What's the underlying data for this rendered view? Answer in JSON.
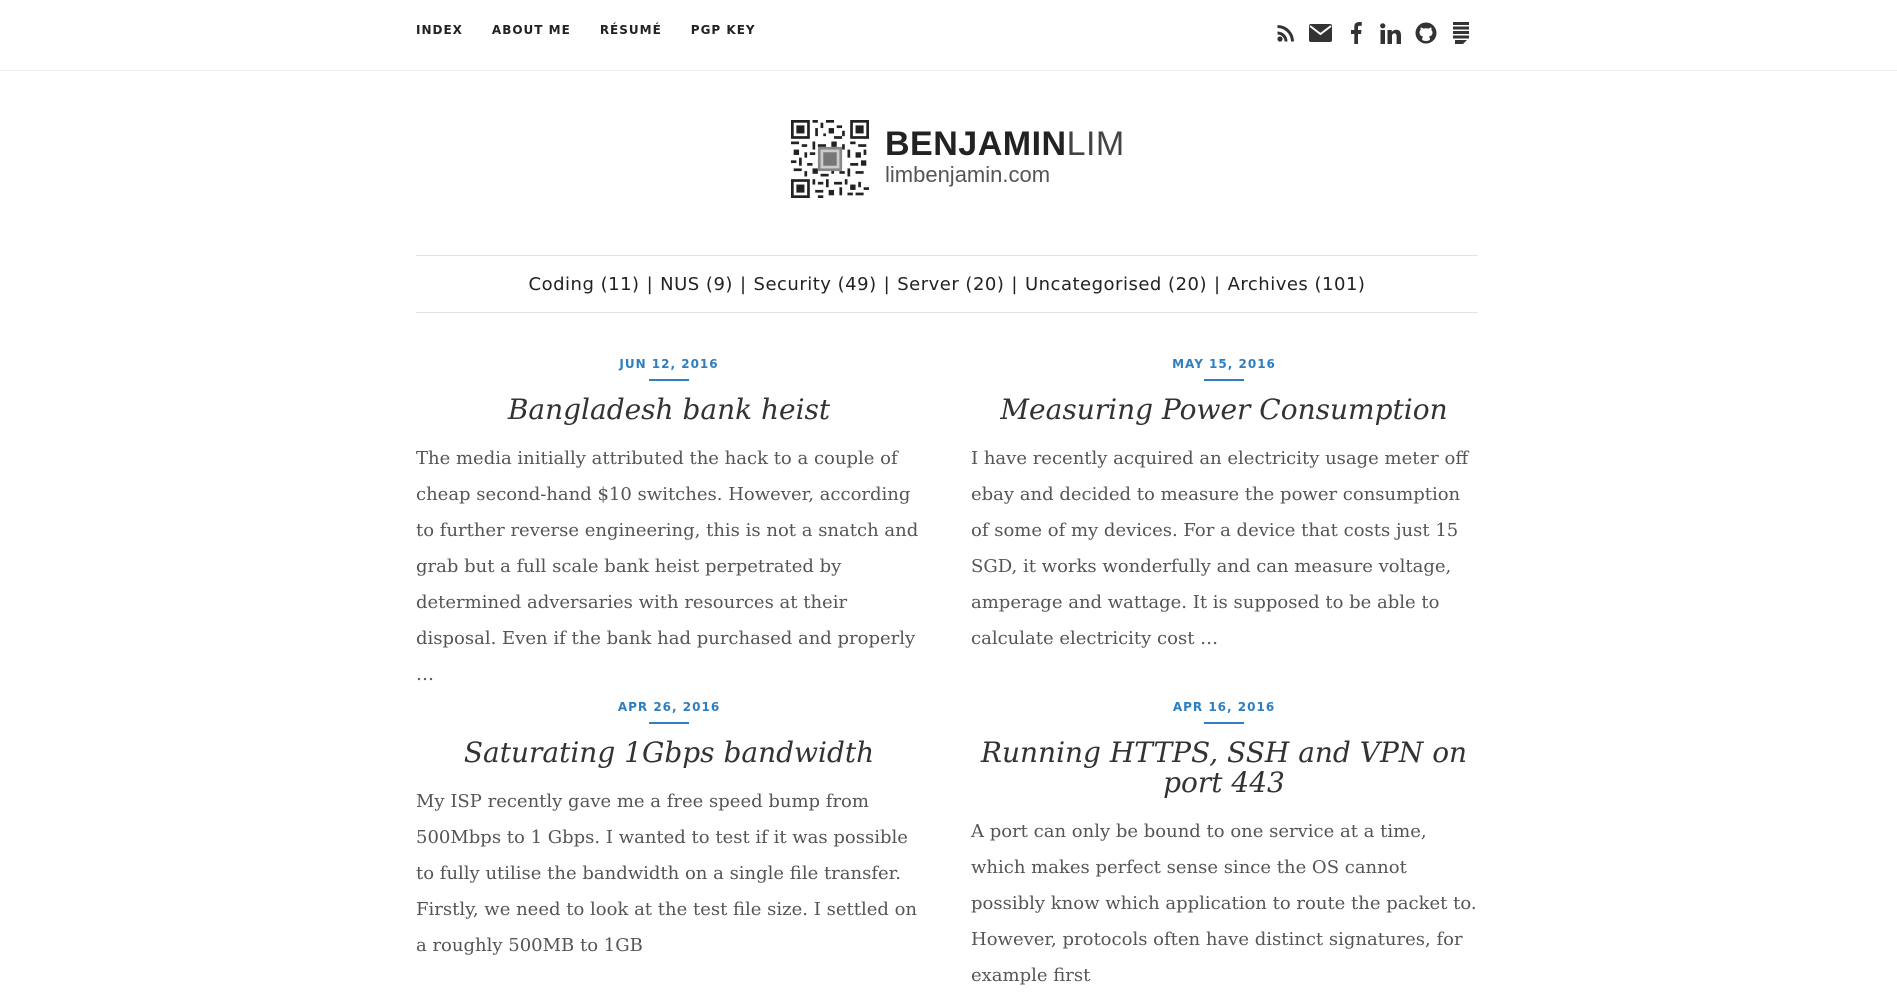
{
  "nav": {
    "links": [
      "INDEX",
      "ABOUT ME",
      "RÉSUMÉ",
      "PGP KEY"
    ]
  },
  "social": {
    "icons": [
      "rss-icon",
      "envelope-icon",
      "facebook-icon",
      "linkedin-icon",
      "github-icon",
      "stackoverflow-icon"
    ],
    "icon_color": "#333333"
  },
  "header": {
    "first_name": "BENJAMIN",
    "last_name": "LIM",
    "url": "limbenjamin.com"
  },
  "categories": [
    {
      "label": "Coding (11)"
    },
    {
      "label": "NUS (9)"
    },
    {
      "label": "Security (49)"
    },
    {
      "label": "Server (20)"
    },
    {
      "label": "Uncategorised (20)"
    },
    {
      "label": "Archives (101)"
    }
  ],
  "posts": [
    {
      "date": "JUN 12, 2016",
      "title": "Bangladesh bank heist",
      "excerpt": "The media initially attributed the hack to a couple of cheap second-hand $10 switches. However, according to further reverse engineering, this is not a snatch and grab but a full scale bank heist perpetrated by determined adversaries with resources at their disposal. Even if the bank had purchased and properly …"
    },
    {
      "date": "MAY 15, 2016",
      "title": "Measuring Power Consumption",
      "excerpt": "I have recently acquired an electricity usage meter off ebay and decided to measure the power consumption of some of my devices. For a device that costs just 15 SGD, it works wonderfully and can measure voltage, amperage and wattage. It is supposed to be able to calculate electricity cost …"
    },
    {
      "date": "APR 26, 2016",
      "title": "Saturating 1Gbps bandwidth",
      "excerpt": "My ISP recently gave me a free speed bump from 500Mbps to 1 Gbps. I wanted to test if it was possible to fully utilise the bandwidth on a single file transfer. Firstly, we need to look at the test file size. I settled on a roughly 500MB to 1GB"
    },
    {
      "date": "APR 16, 2016",
      "title": "Running HTTPS, SSH and VPN on port 443",
      "excerpt": "A port can only be bound to one service at a time, which makes perfect sense since the OS cannot possibly know which application to route the packet to. However, protocols often have distinct signatures, for example first"
    }
  ],
  "colors": {
    "accent": "#2d7fc1",
    "text": "#333333",
    "excerpt": "#555555"
  }
}
